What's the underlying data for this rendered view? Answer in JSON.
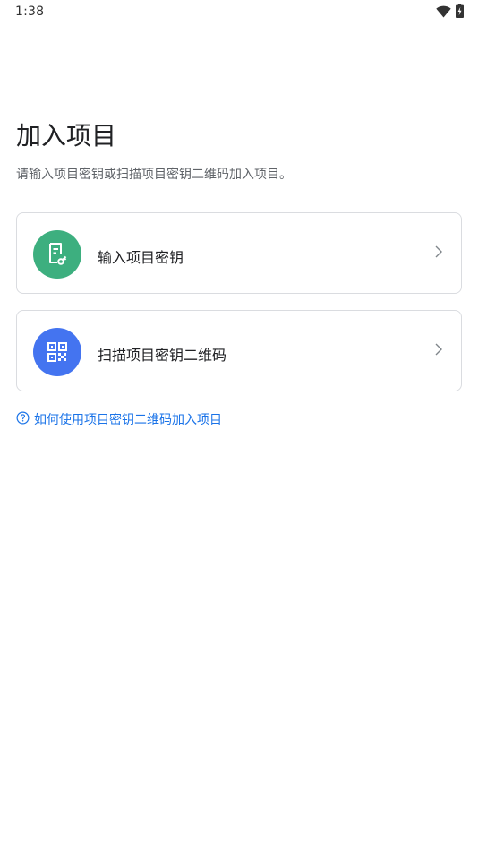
{
  "status_bar": {
    "time": "1:38"
  },
  "header": {
    "title": "加入项目",
    "subtitle": "请输入项目密钥或扫描项目密钥二维码加入项目。"
  },
  "options": [
    {
      "label": "输入项目密钥",
      "icon": "document-key-icon",
      "icon_bg": "#3daf7f"
    },
    {
      "label": "扫描项目密钥二维码",
      "icon": "qr-code-icon",
      "icon_bg": "#4474f0"
    }
  ],
  "help": {
    "label": "如何使用项目密钥二维码加入项目",
    "icon": "help-circle-icon",
    "color": "#1a73e8"
  }
}
